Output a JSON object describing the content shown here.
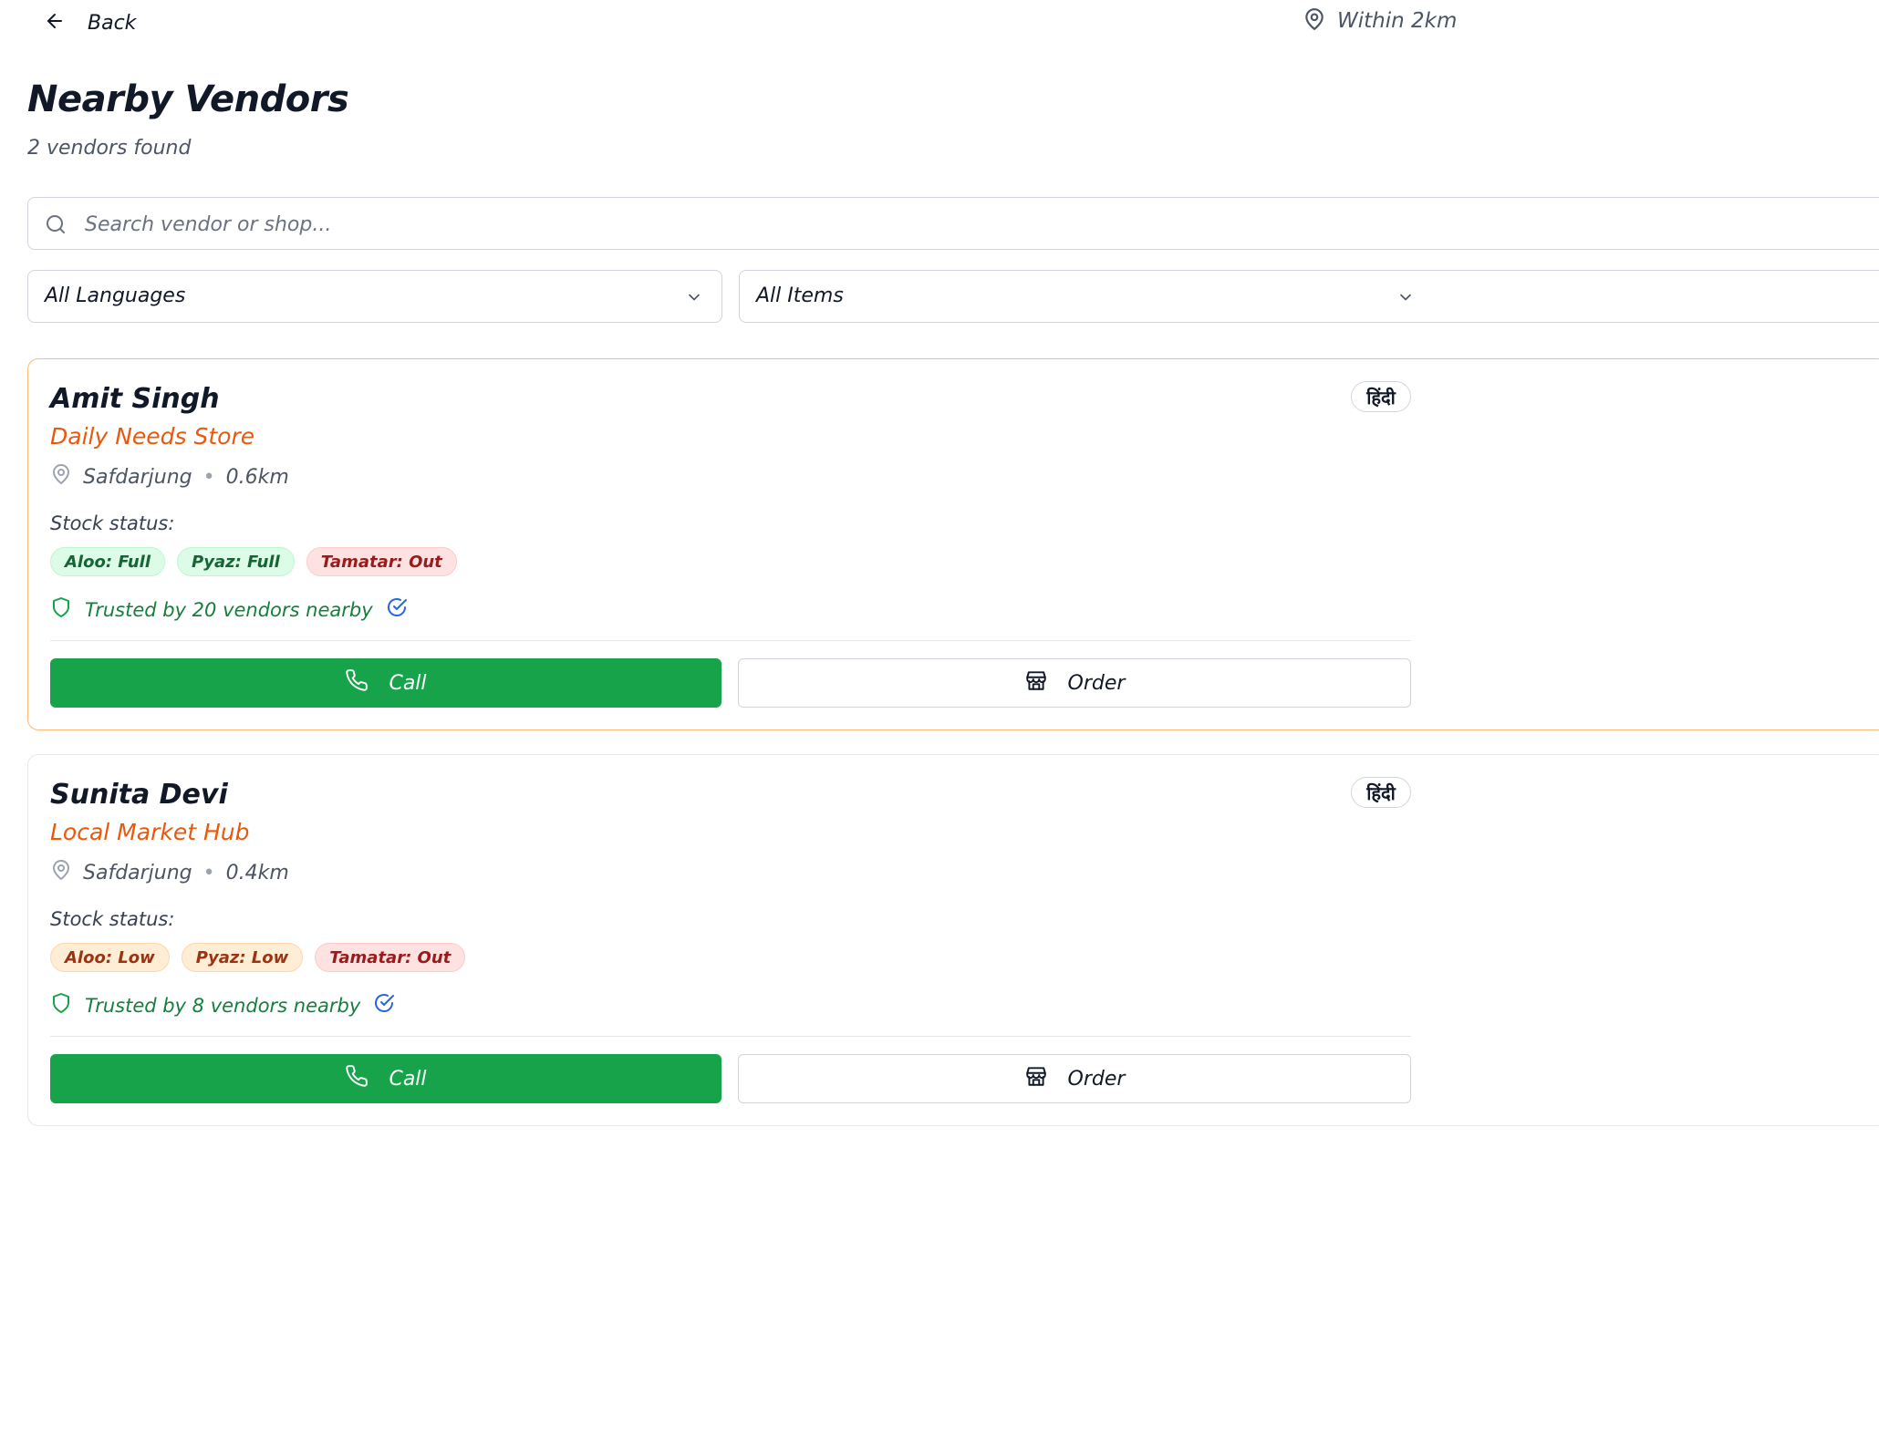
{
  "header": {
    "back_label": "Back",
    "radius_label": "Within 2km",
    "back_icon": "arrow-left-icon",
    "radius_icon": "map-pin-icon"
  },
  "page": {
    "title": "Nearby Vendors",
    "count_text": "2 vendors found"
  },
  "search": {
    "placeholder": "Search vendor or shop...",
    "value": ""
  },
  "filters": {
    "language": "All Languages",
    "items": "All Items"
  },
  "labels": {
    "stock_status": "Stock status:",
    "call": "Call",
    "order": "Order",
    "separator": "•"
  },
  "vendors": [
    {
      "name": "Amit Singh",
      "shop": "Daily Needs Store",
      "area": "Safdarjung",
      "distance": "0.6km",
      "language": "हिंदी",
      "highlighted": true,
      "stock": [
        {
          "text": "Aloo: Full",
          "level": "full"
        },
        {
          "text": "Pyaz: Full",
          "level": "full"
        },
        {
          "text": "Tamatar: Out",
          "level": "out"
        }
      ],
      "trust": "Trusted by 20 vendors nearby"
    },
    {
      "name": "Sunita Devi",
      "shop": "Local Market Hub",
      "area": "Safdarjung",
      "distance": "0.4km",
      "language": "हिंदी",
      "highlighted": false,
      "stock": [
        {
          "text": "Aloo: Low",
          "level": "low"
        },
        {
          "text": "Pyaz: Low",
          "level": "low"
        },
        {
          "text": "Tamatar: Out",
          "level": "out"
        }
      ],
      "trust": "Trusted by 8 vendors nearby"
    }
  ],
  "colors": {
    "accent_green": "#16a34a",
    "shop_orange": "#ea580c",
    "highlight_border": "#fdba74",
    "verified_blue": "#2563eb",
    "full_bg": "#dcfce7",
    "low_bg": "#ffedd5",
    "out_bg": "#fee2e2"
  }
}
